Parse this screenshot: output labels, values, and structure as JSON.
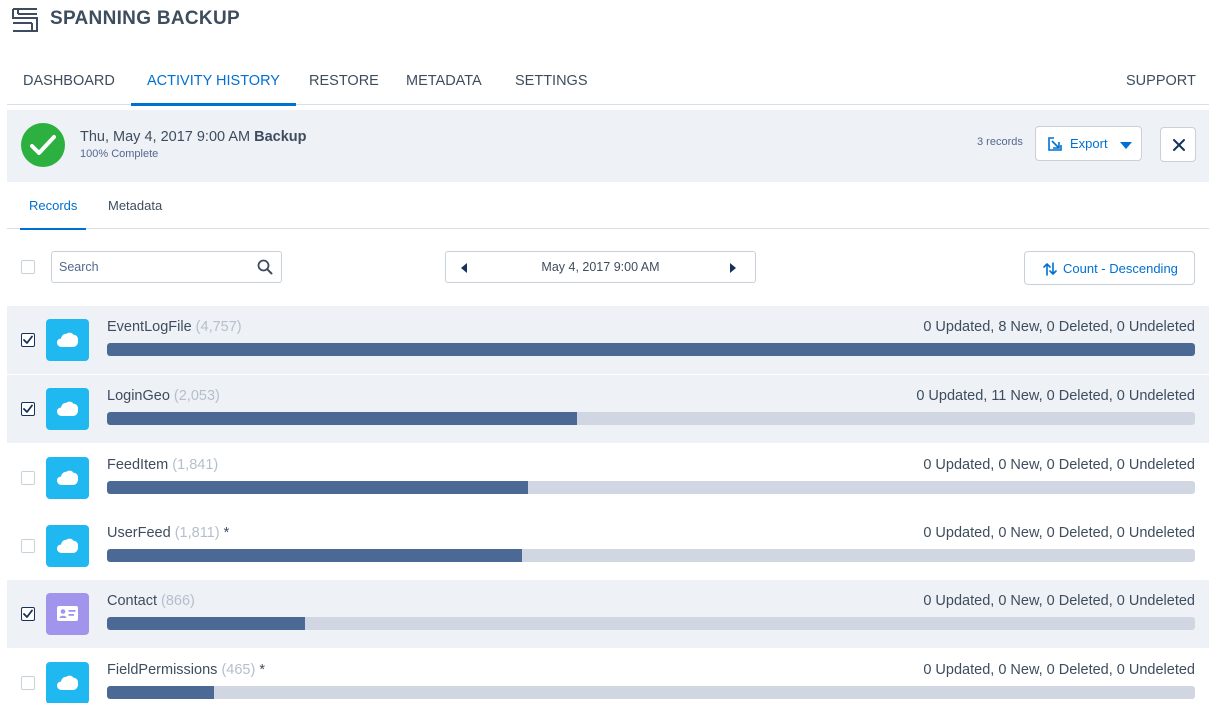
{
  "app": {
    "title": "SPANNING BACKUP",
    "logo_icon": "spanning-logo-icon"
  },
  "nav": {
    "tabs": [
      {
        "label": "DASHBOARD",
        "active": false
      },
      {
        "label": "ACTIVITY HISTORY",
        "active": true
      },
      {
        "label": "RESTORE",
        "active": false
      },
      {
        "label": "METADATA",
        "active": false
      },
      {
        "label": "SETTINGS",
        "active": false
      }
    ],
    "support": "SUPPORT"
  },
  "summary": {
    "datetime": "Thu, May 4, 2017 9:00 AM",
    "type": "Backup",
    "progress_text": "100% Complete",
    "record_count": "3 records",
    "export_label": "Export",
    "status_icon": "check-circle-icon"
  },
  "sub_tabs": [
    {
      "label": "Records",
      "active": true
    },
    {
      "label": "Metadata",
      "active": false
    }
  ],
  "toolbar": {
    "search_placeholder": "Search",
    "search_value": "",
    "date_label": "May 4, 2017 9:00 AM",
    "sort_label": "Count - Descending"
  },
  "colors": {
    "accent": "#0070d2",
    "success": "#2cb03f",
    "bar_fill": "#4c6895",
    "bar_track": "#d0d7e2",
    "salesforce_icon": "#1fb8f0",
    "contact_icon": "#a094ed"
  },
  "rows": [
    {
      "name": "EventLogFile",
      "count": "(4,757)",
      "star": "",
      "stats": "0 Updated, 8 New, 0 Deleted, 0 Undeleted",
      "checked": true,
      "icon": "salesforce-cloud-icon",
      "progress": 1.0
    },
    {
      "name": "LoginGeo",
      "count": "(2,053)",
      "star": "",
      "stats": "0 Updated, 11 New, 0 Deleted, 0 Undeleted",
      "checked": true,
      "icon": "salesforce-cloud-icon",
      "progress": 0.432
    },
    {
      "name": "FeedItem",
      "count": "(1,841)",
      "star": "",
      "stats": "0 Updated, 0 New, 0 Deleted, 0 Undeleted",
      "checked": false,
      "icon": "salesforce-cloud-icon",
      "progress": 0.387
    },
    {
      "name": "UserFeed",
      "count": "(1,811)",
      "star": "*",
      "stats": "0 Updated, 0 New, 0 Deleted, 0 Undeleted",
      "checked": false,
      "icon": "salesforce-cloud-icon",
      "progress": 0.381
    },
    {
      "name": "Contact",
      "count": "(866)",
      "star": "",
      "stats": "0 Updated, 0 New, 0 Deleted, 0 Undeleted",
      "checked": true,
      "icon": "contact-card-icon",
      "progress": 0.182
    },
    {
      "name": "FieldPermissions",
      "count": "(465)",
      "star": "*",
      "stats": "0 Updated, 0 New, 0 Deleted, 0 Undeleted",
      "checked": false,
      "icon": "salesforce-cloud-icon",
      "progress": 0.098
    }
  ]
}
